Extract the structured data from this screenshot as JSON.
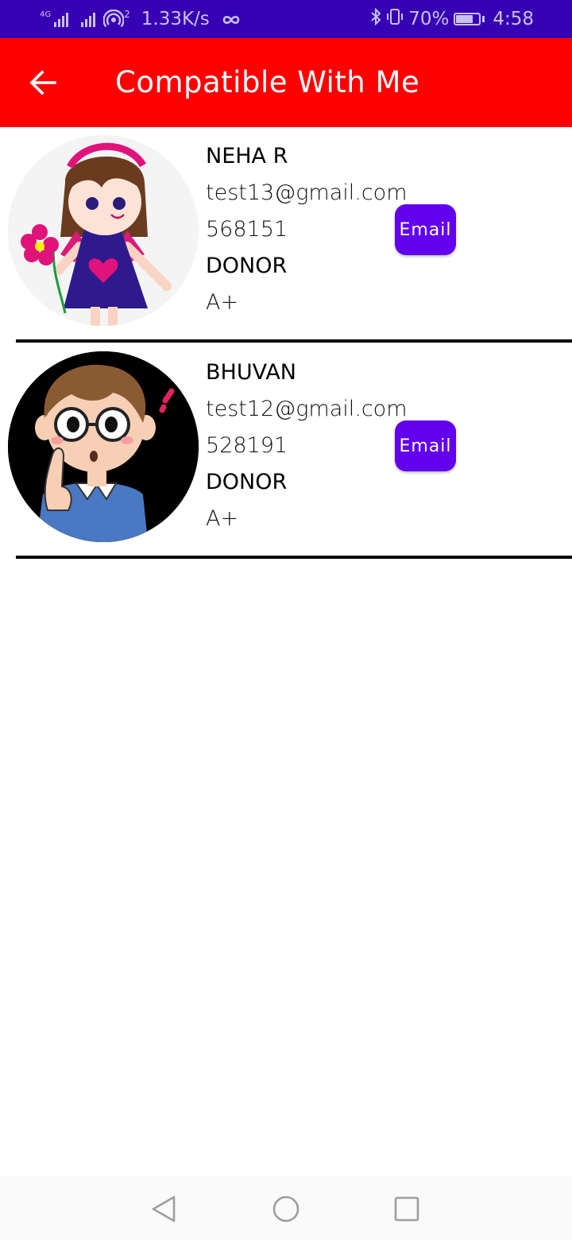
{
  "status_bar": {
    "network_type": "4G",
    "data_speed": "1.33K/s",
    "hotspot_count": "2",
    "battery_percent": "70%",
    "battery_level": 0.7,
    "time": "4:58"
  },
  "app_bar": {
    "title": "Compatible With Me",
    "background": "#ff0000"
  },
  "contacts": [
    {
      "name": "NEHA R",
      "email": "test13@gmail.com",
      "pin": "568151",
      "role": "DONOR",
      "blood_group": "A+",
      "button_label": "Email",
      "avatar": "girl-avatar-icon"
    },
    {
      "name": "BHUVAN",
      "email": "test12@gmail.com",
      "pin": "528191",
      "role": "DONOR",
      "blood_group": "A+",
      "button_label": "Email",
      "avatar": "boy-avatar-icon"
    }
  ],
  "colors": {
    "status_bar": "#3700b3",
    "accent_button": "#6200ee",
    "divider": "#000000"
  }
}
